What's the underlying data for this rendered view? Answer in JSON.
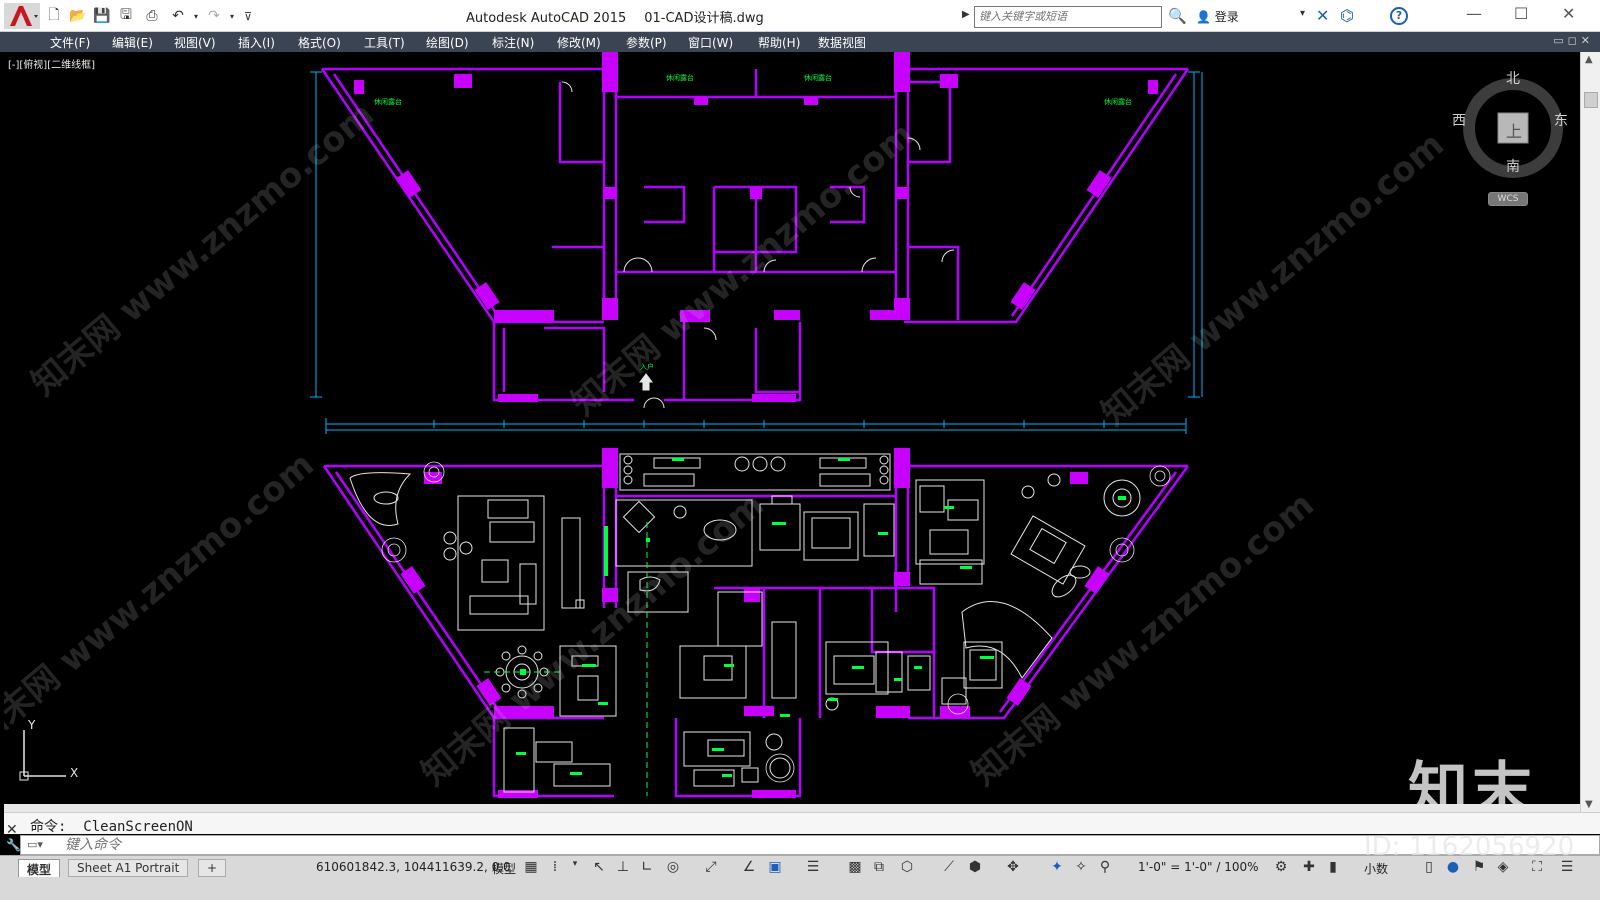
{
  "window": {
    "app_name": "Autodesk AutoCAD 2015",
    "file_name": "01-CAD设计稿.dwg"
  },
  "search": {
    "placeholder": "键入关键字或短语"
  },
  "account": {
    "login_label": "登录"
  },
  "menu": {
    "items": [
      "文件(F)",
      "编辑(E)",
      "视图(V)",
      "插入(I)",
      "格式(O)",
      "工具(T)",
      "绘图(D)",
      "标注(N)",
      "修改(M)",
      "参数(P)",
      "窗口(W)",
      "帮助(H)",
      "数据视图"
    ]
  },
  "viewport": {
    "label": "[-][俯视][二维线框]"
  },
  "viewcube": {
    "north": "北",
    "south": "南",
    "east": "东",
    "west": "西",
    "top": "上",
    "wcs": "WCS"
  },
  "ucs": {
    "x": "X",
    "y": "Y"
  },
  "drawing_labels": {
    "terrace": "休闲露台",
    "entrance": "入户"
  },
  "watermark": {
    "text": "知末网 www.znzmo.com"
  },
  "command": {
    "history": "命令: _CleanScreenON",
    "placeholder": "键入命令"
  },
  "status": {
    "tabs": [
      "模型",
      "Sheet A1 Portrait"
    ],
    "coords": "610601842.3, 104411639.2, 0.0",
    "space": "模型",
    "scale": "1'-0\" = 1'-0\" / 100%",
    "units": "小数"
  },
  "brand": {
    "logo": "知末",
    "id": "ID: 1162056920"
  },
  "colors": {
    "wall": "#b400ff",
    "wall_fill": "#c800ff",
    "cyan": "#00b4ff",
    "green": "#00ff3c",
    "white_line": "#e6e6e6",
    "menubar": "#3b4453"
  }
}
